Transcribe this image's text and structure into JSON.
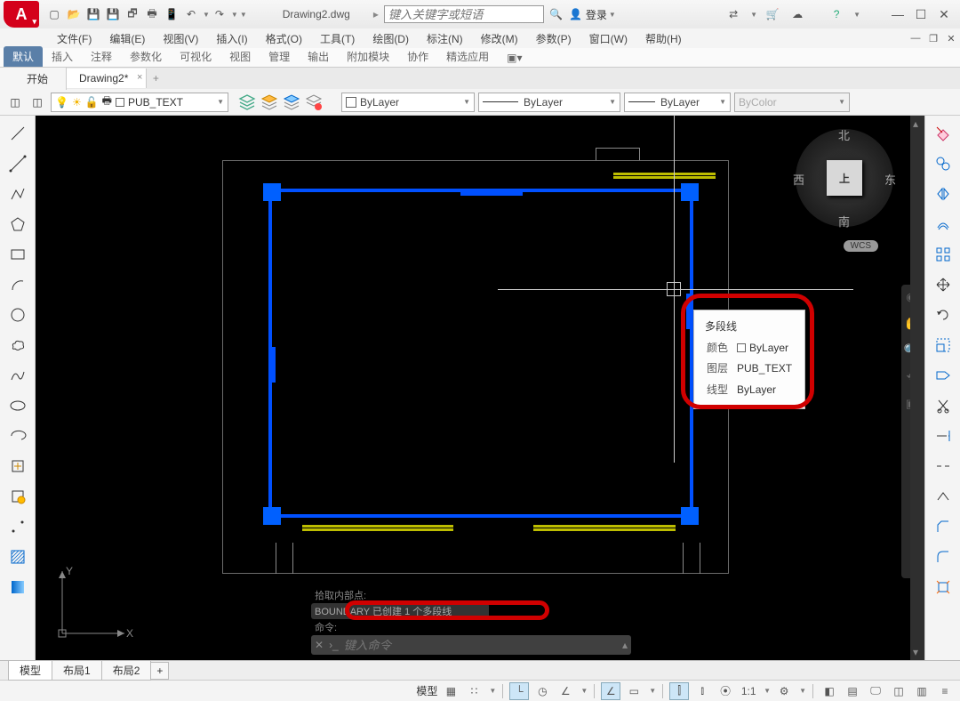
{
  "app": {
    "letter": "A"
  },
  "title": {
    "filename": "Drawing2.dwg",
    "search_placeholder": "键入关键字或短语",
    "login": "登录"
  },
  "menus": [
    "文件(F)",
    "编辑(E)",
    "视图(V)",
    "插入(I)",
    "格式(O)",
    "工具(T)",
    "绘图(D)",
    "标注(N)",
    "修改(M)",
    "参数(P)",
    "窗口(W)",
    "帮助(H)"
  ],
  "ribbon": [
    "默认",
    "插入",
    "注释",
    "参数化",
    "可视化",
    "视图",
    "管理",
    "输出",
    "附加模块",
    "协作",
    "精选应用"
  ],
  "ribbon_active": 0,
  "doctabs": {
    "start": "开始",
    "active": "Drawing2*",
    "add": "+"
  },
  "layer": {
    "current": "PUB_TEXT",
    "color_dd": "ByLayer",
    "lw_dd": "ByLayer",
    "lt_dd": "ByLayer",
    "plot_dd": "ByColor"
  },
  "tooltip": {
    "title": "多段线",
    "rows": [
      {
        "k": "颜色",
        "v": "ByLayer",
        "swatch": true
      },
      {
        "k": "图层",
        "v": "PUB_TEXT"
      },
      {
        "k": "线型",
        "v": "ByLayer"
      }
    ]
  },
  "viewcube": {
    "n": "北",
    "s": "南",
    "e": "东",
    "w": "西",
    "top": "上",
    "wcs": "WCS"
  },
  "cmd": {
    "hist1": "拾取内部点:",
    "hist2_a": "BOUNDARY",
    "hist2_b": "已创建",
    "hist2_c": "1",
    "hist2_d": "个多段线",
    "hist3": "命令:",
    "placeholder": "键入命令"
  },
  "layouts": [
    "模型",
    "布局1",
    "布局2"
  ],
  "status": {
    "space": "模型",
    "scale": "1:1"
  },
  "ucs": {
    "x": "X",
    "y": "Y"
  }
}
